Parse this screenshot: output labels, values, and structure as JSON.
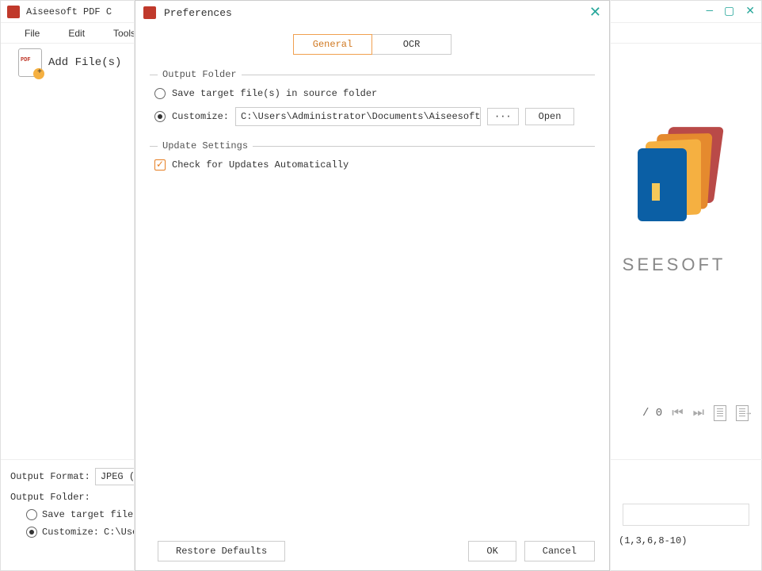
{
  "mainWindow": {
    "title": "Aiseesoft PDF C",
    "menu": [
      "File",
      "Edit",
      "Tools"
    ],
    "toolbar": {
      "addFilesLabel": "Add File(s)"
    }
  },
  "logoText": "SEESOFT",
  "previewPager": {
    "sep": "/ 0"
  },
  "bottomPanel": {
    "outputFormatLabel": "Output Format:",
    "outputFormatValue": "JPEG (*.",
    "outputFolderLabel": "Output Folder:",
    "saveInSourceLabel": "Save target file(",
    "customizeLabel": "Customize:",
    "customizePath": "C:\\Use"
  },
  "pageRange": "(1,3,6,8-10)",
  "preferences": {
    "dialogTitle": "Preferences",
    "tabs": {
      "general": "General",
      "ocr": "OCR"
    },
    "outputFolder": {
      "legend": "Output Folder",
      "saveInSource": "Save target file(s) in source folder",
      "customize": "Customize:",
      "path": "C:\\Users\\Administrator\\Documents\\Aiseesoft Studio\\Aiseesoft PD",
      "browseBtn": "···",
      "openBtn": "Open"
    },
    "updateSettings": {
      "legend": "Update Settings",
      "checkLabel": "Check for Updates Automatically"
    },
    "footer": {
      "restore": "Restore Defaults",
      "ok": "OK",
      "cancel": "Cancel"
    }
  }
}
